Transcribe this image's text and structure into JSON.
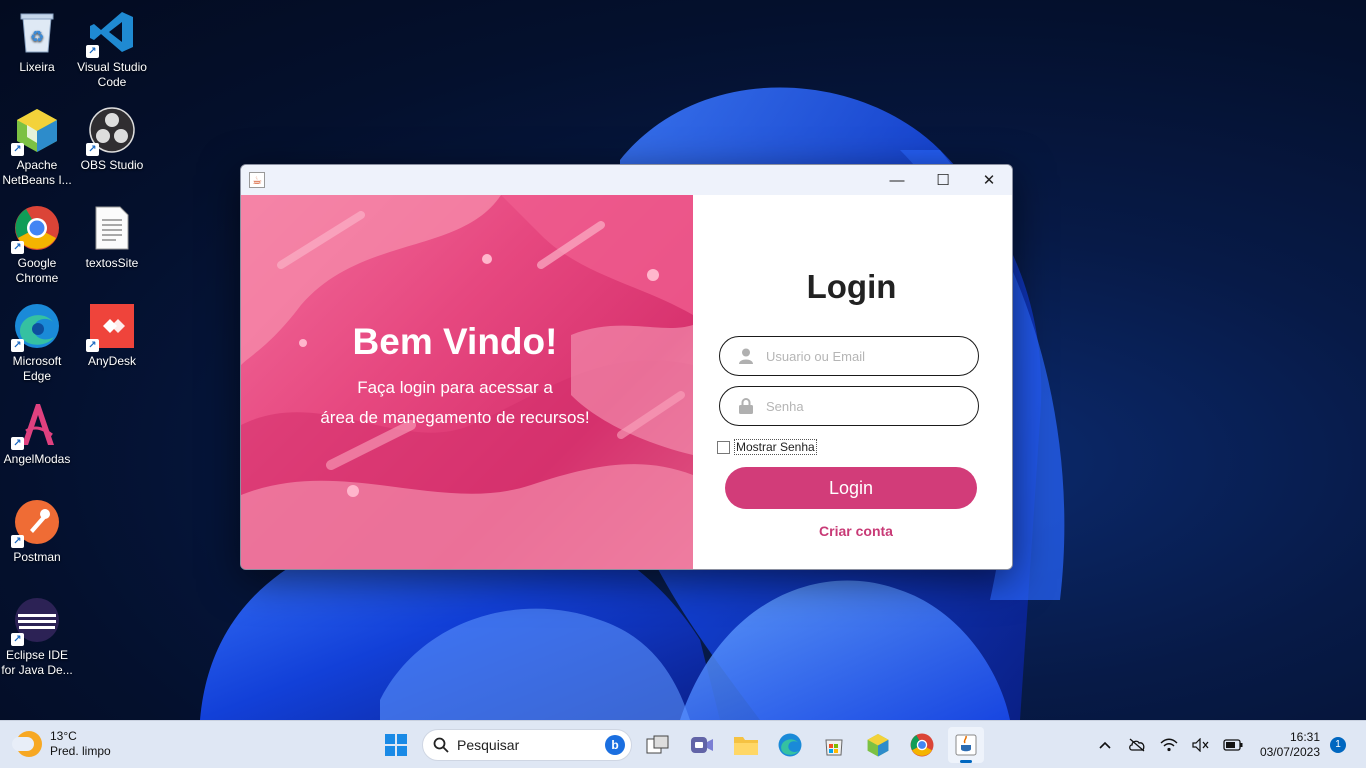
{
  "desktop": {
    "icons": [
      {
        "label": "Lixeira",
        "icon": "recycle-bin-icon"
      },
      {
        "label": "Visual Studio Code",
        "icon": "vscode-icon"
      },
      {
        "label": "Apache NetBeans I...",
        "icon": "netbeans-icon"
      },
      {
        "label": "OBS Studio",
        "icon": "obs-icon"
      },
      {
        "label": "Google Chrome",
        "icon": "chrome-icon"
      },
      {
        "label": "textosSite",
        "icon": "text-file-icon"
      },
      {
        "label": "Microsoft Edge",
        "icon": "edge-icon"
      },
      {
        "label": "AnyDesk",
        "icon": "anydesk-icon"
      },
      {
        "label": "AngelModas",
        "icon": "angelmodas-icon"
      },
      {
        "label": "Postman",
        "icon": "postman-icon"
      },
      {
        "label": "Eclipse IDE for Java De...",
        "icon": "eclipse-icon"
      }
    ]
  },
  "window": {
    "controls": {
      "minimize": "—",
      "maximize": "☐",
      "close": "✕"
    },
    "welcome": {
      "title": "Bem Vindo!",
      "subtitle_line1": "Faça login para acessar a",
      "subtitle_line2": "área de manegamento de recursos!"
    },
    "login": {
      "title": "Login",
      "user_placeholder": "Usuario ou Email",
      "password_placeholder": "Senha",
      "show_password_label": "Mostrar Senha",
      "login_button": "Login",
      "create_account": "Criar conta"
    },
    "colors": {
      "accent": "#d23c79",
      "link": "#c83a76"
    }
  },
  "taskbar": {
    "weather_temp": "13°C",
    "weather_desc": "Pred. limpo",
    "search_label": "Pesquisar",
    "time": "16:31",
    "date": "03/07/2023",
    "notification_count": "1"
  }
}
